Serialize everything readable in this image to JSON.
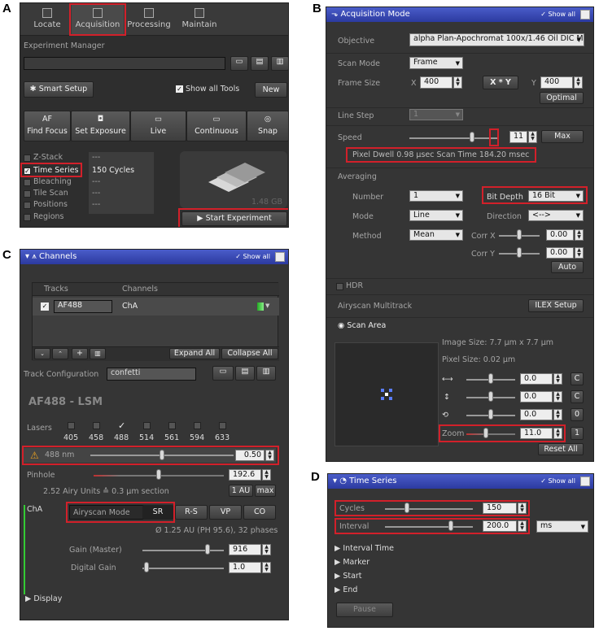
{
  "panel_labels": {
    "a": "A",
    "b": "B",
    "c": "C",
    "d": "D"
  },
  "a": {
    "tabs": [
      {
        "label": "Locate"
      },
      {
        "label": "Acquisition"
      },
      {
        "label": "Processing"
      },
      {
        "label": "Maintain"
      }
    ],
    "experiment_manager": "Experiment Manager",
    "smart_setup": "Smart Setup",
    "show_all_tools": "Show all Tools",
    "new_label": "New",
    "toolbar": [
      {
        "top": "AF",
        "label": "Find Focus"
      },
      {
        "label": "Set Exposure"
      },
      {
        "label": "Live"
      },
      {
        "label": "Continuous"
      },
      {
        "label": "Snap"
      }
    ],
    "options": [
      {
        "label": "Z-Stack",
        "value": "---"
      },
      {
        "label": "Time Series",
        "value": "150 Cycles"
      },
      {
        "label": "Bleaching",
        "value": "---"
      },
      {
        "label": "Tile Scan",
        "value": "---"
      },
      {
        "label": "Positions",
        "value": "---"
      },
      {
        "label": "Regions",
        "value": ""
      }
    ],
    "storage": "1.48 GB",
    "start_experiment": "Start Experiment"
  },
  "b": {
    "title": "Acquisition Mode",
    "show_all": "✓ Show all",
    "objective_label": "Objective",
    "objective_value": "alpha Plan-Apochromat 100x/1.46 Oil DIC M",
    "scan_mode_label": "Scan Mode",
    "scan_mode_value": "Frame",
    "frame_size_label": "Frame Size",
    "x_label": "X",
    "x_value": "400",
    "xy_button": "X * Y",
    "y_label": "Y",
    "y_value": "400",
    "optimal": "Optimal",
    "line_step_label": "Line Step",
    "line_step_value": "1",
    "speed_label": "Speed",
    "speed_value": "11",
    "max": "Max",
    "pixel_dwell": "Pixel Dwell   0.98 µsec   Scan Time   184.20 msec",
    "averaging": "Averaging",
    "number_label": "Number",
    "number_value": "1",
    "bit_depth_label": "Bit Depth",
    "bit_depth_value": "16 Bit",
    "mode_label": "Mode",
    "mode_value": "Line",
    "direction_label": "Direction",
    "direction_value": "<-->",
    "method_label": "Method",
    "method_value": "Mean",
    "corr_x_label": "Corr X",
    "corr_x_value": "0.00",
    "corr_y_label": "Corr Y",
    "corr_y_value": "0.00",
    "auto": "Auto",
    "hdr": "HDR",
    "airyscan": "Airyscan Multitrack",
    "ilex": "ILEX Setup",
    "scan_area": "Scan Area",
    "image_size": "Image Size:  7.7  µm x 7.7  µm",
    "pixel_size": "Pixel Size:   0.02  µm",
    "offset_x": "0.0",
    "offset_y": "0.0",
    "rotation": "0.0",
    "c_label": "C",
    "zero_label": "0",
    "one_label": "1",
    "zoom_label": "Zoom",
    "zoom_value": "11.0",
    "reset_all": "Reset All"
  },
  "c": {
    "title": "Channels",
    "show_all": "✓ Show all",
    "tracks_header": "Tracks",
    "channels_header": "Channels",
    "track_name": "AF488",
    "channel_name": "ChA",
    "expand_all": "Expand All",
    "collapse_all": "Collapse All",
    "track_config_label": "Track Configuration",
    "track_config_value": "confetti",
    "section_title": "AF488 - LSM",
    "lasers_label": "Lasers",
    "lasers": [
      {
        "wl": "405",
        "on": false
      },
      {
        "wl": "458",
        "on": false
      },
      {
        "wl": "488",
        "on": true
      },
      {
        "wl": "514",
        "on": false
      },
      {
        "wl": "561",
        "on": false
      },
      {
        "wl": "594",
        "on": false
      },
      {
        "wl": "633",
        "on": false
      }
    ],
    "laser_nm": "488 nm",
    "laser_power": "0.50",
    "pinhole_label": "Pinhole",
    "pinhole_value": "192.6",
    "airy_units": "2.52 Airy Units  ≙  0.3 µm section",
    "one_au": "1 AU",
    "max": "max",
    "cha": "ChA",
    "airyscan_mode": "Airyscan Mode",
    "modes": [
      "SR",
      "R-S",
      "VP",
      "CO"
    ],
    "phases": "Ø 1.25 AU (PH 95.6), 32 phases",
    "gain_label": "Gain (Master)",
    "gain_value": "916",
    "digital_gain_label": "Digital Gain",
    "digital_gain_value": "1.0",
    "display": "Display"
  },
  "d": {
    "title": "Time Series",
    "show_all": "✓ Show all",
    "cycles_label": "Cycles",
    "cycles_value": "150",
    "interval_label": "Interval",
    "interval_value": "200.0",
    "unit": "ms",
    "items": [
      "Interval Time",
      "Marker",
      "Start",
      "End"
    ],
    "pause": "Pause"
  },
  "levels": {
    "speed": 0.7,
    "laser_power": 0.5,
    "pinhole": 0.5,
    "gain": 0.8,
    "digital_gain": 0.05,
    "cycles": 0.25,
    "interval": 0.75,
    "zoom": 0.4
  }
}
